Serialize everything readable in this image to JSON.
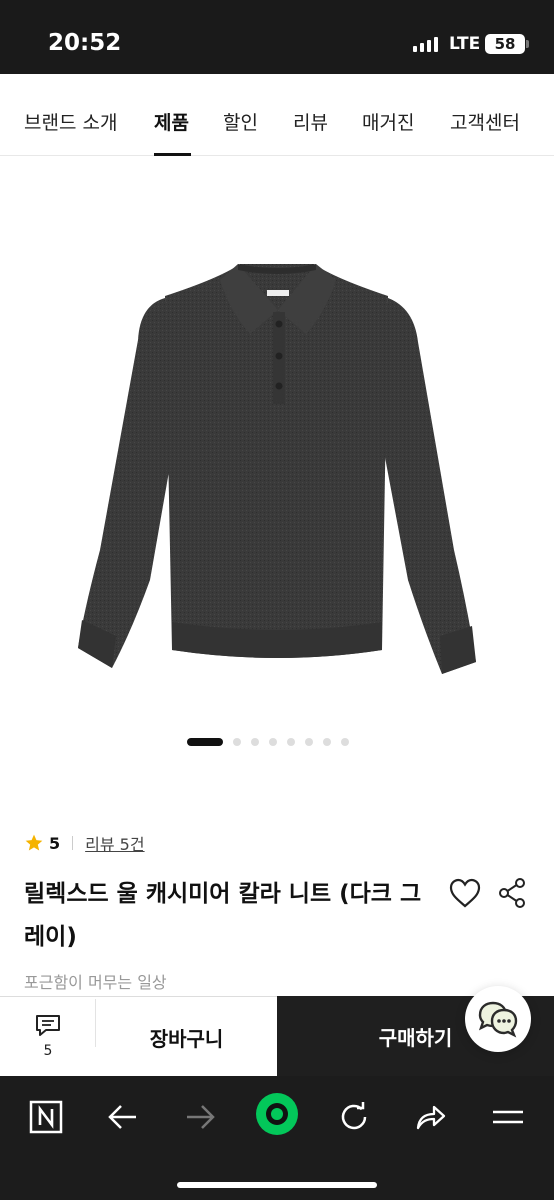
{
  "status_bar": {
    "time": "20:52",
    "network": "LTE",
    "battery": "58"
  },
  "nav": {
    "tabs": [
      {
        "label": "브랜드 소개",
        "active": false
      },
      {
        "label": "제품",
        "active": true
      },
      {
        "label": "할인",
        "active": false
      },
      {
        "label": "리뷰",
        "active": false
      },
      {
        "label": "매거진",
        "active": false
      },
      {
        "label": "고객센터",
        "active": false
      }
    ]
  },
  "gallery": {
    "total_images": 8,
    "current_index": 1
  },
  "product": {
    "rating": "5",
    "review_link": "리뷰 5건",
    "title": "릴렉스드 울 캐시미어 칼라 니트 (다크 그레이)",
    "subtitle": "포근함이 머무는 일상"
  },
  "actions": {
    "review_count": "5",
    "cart_label": "장바구니",
    "buy_label": "구매하기"
  },
  "colors": {
    "accent_star": "#f5b300",
    "buy_button": "#1f1f1f",
    "browser_accent": "#03c75a"
  },
  "icons": [
    "star-icon",
    "heart-icon",
    "share-icon",
    "chat-icon",
    "review-icon",
    "naver-icon",
    "back-icon",
    "forward-icon",
    "green-dot-icon",
    "refresh-icon",
    "share-forward-icon",
    "menu-icon"
  ]
}
